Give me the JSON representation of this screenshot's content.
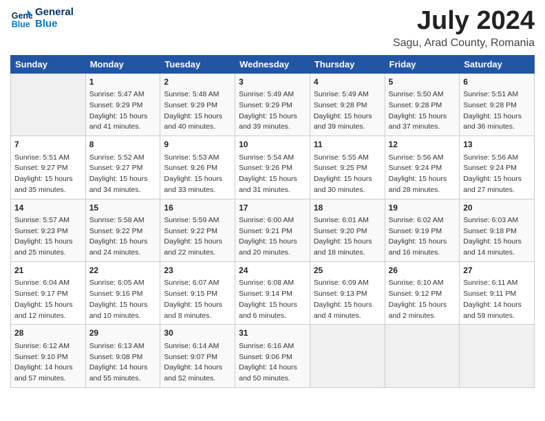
{
  "logo": {
    "line1": "General",
    "line2": "Blue"
  },
  "title": "July 2024",
  "subtitle": "Sagu, Arad County, Romania",
  "days_of_week": [
    "Sunday",
    "Monday",
    "Tuesday",
    "Wednesday",
    "Thursday",
    "Friday",
    "Saturday"
  ],
  "weeks": [
    [
      {
        "day": "",
        "info": ""
      },
      {
        "day": "1",
        "info": "Sunrise: 5:47 AM\nSunset: 9:29 PM\nDaylight: 15 hours\nand 41 minutes."
      },
      {
        "day": "2",
        "info": "Sunrise: 5:48 AM\nSunset: 9:29 PM\nDaylight: 15 hours\nand 40 minutes."
      },
      {
        "day": "3",
        "info": "Sunrise: 5:49 AM\nSunset: 9:29 PM\nDaylight: 15 hours\nand 39 minutes."
      },
      {
        "day": "4",
        "info": "Sunrise: 5:49 AM\nSunset: 9:28 PM\nDaylight: 15 hours\nand 39 minutes."
      },
      {
        "day": "5",
        "info": "Sunrise: 5:50 AM\nSunset: 9:28 PM\nDaylight: 15 hours\nand 37 minutes."
      },
      {
        "day": "6",
        "info": "Sunrise: 5:51 AM\nSunset: 9:28 PM\nDaylight: 15 hours\nand 36 minutes."
      }
    ],
    [
      {
        "day": "7",
        "info": "Sunrise: 5:51 AM\nSunset: 9:27 PM\nDaylight: 15 hours\nand 35 minutes."
      },
      {
        "day": "8",
        "info": "Sunrise: 5:52 AM\nSunset: 9:27 PM\nDaylight: 15 hours\nand 34 minutes."
      },
      {
        "day": "9",
        "info": "Sunrise: 5:53 AM\nSunset: 9:26 PM\nDaylight: 15 hours\nand 33 minutes."
      },
      {
        "day": "10",
        "info": "Sunrise: 5:54 AM\nSunset: 9:26 PM\nDaylight: 15 hours\nand 31 minutes."
      },
      {
        "day": "11",
        "info": "Sunrise: 5:55 AM\nSunset: 9:25 PM\nDaylight: 15 hours\nand 30 minutes."
      },
      {
        "day": "12",
        "info": "Sunrise: 5:56 AM\nSunset: 9:24 PM\nDaylight: 15 hours\nand 28 minutes."
      },
      {
        "day": "13",
        "info": "Sunrise: 5:56 AM\nSunset: 9:24 PM\nDaylight: 15 hours\nand 27 minutes."
      }
    ],
    [
      {
        "day": "14",
        "info": "Sunrise: 5:57 AM\nSunset: 9:23 PM\nDaylight: 15 hours\nand 25 minutes."
      },
      {
        "day": "15",
        "info": "Sunrise: 5:58 AM\nSunset: 9:22 PM\nDaylight: 15 hours\nand 24 minutes."
      },
      {
        "day": "16",
        "info": "Sunrise: 5:59 AM\nSunset: 9:22 PM\nDaylight: 15 hours\nand 22 minutes."
      },
      {
        "day": "17",
        "info": "Sunrise: 6:00 AM\nSunset: 9:21 PM\nDaylight: 15 hours\nand 20 minutes."
      },
      {
        "day": "18",
        "info": "Sunrise: 6:01 AM\nSunset: 9:20 PM\nDaylight: 15 hours\nand 18 minutes."
      },
      {
        "day": "19",
        "info": "Sunrise: 6:02 AM\nSunset: 9:19 PM\nDaylight: 15 hours\nand 16 minutes."
      },
      {
        "day": "20",
        "info": "Sunrise: 6:03 AM\nSunset: 9:18 PM\nDaylight: 15 hours\nand 14 minutes."
      }
    ],
    [
      {
        "day": "21",
        "info": "Sunrise: 6:04 AM\nSunset: 9:17 PM\nDaylight: 15 hours\nand 12 minutes."
      },
      {
        "day": "22",
        "info": "Sunrise: 6:05 AM\nSunset: 9:16 PM\nDaylight: 15 hours\nand 10 minutes."
      },
      {
        "day": "23",
        "info": "Sunrise: 6:07 AM\nSunset: 9:15 PM\nDaylight: 15 hours\nand 8 minutes."
      },
      {
        "day": "24",
        "info": "Sunrise: 6:08 AM\nSunset: 9:14 PM\nDaylight: 15 hours\nand 6 minutes."
      },
      {
        "day": "25",
        "info": "Sunrise: 6:09 AM\nSunset: 9:13 PM\nDaylight: 15 hours\nand 4 minutes."
      },
      {
        "day": "26",
        "info": "Sunrise: 6:10 AM\nSunset: 9:12 PM\nDaylight: 15 hours\nand 2 minutes."
      },
      {
        "day": "27",
        "info": "Sunrise: 6:11 AM\nSunset: 9:11 PM\nDaylight: 14 hours\nand 59 minutes."
      }
    ],
    [
      {
        "day": "28",
        "info": "Sunrise: 6:12 AM\nSunset: 9:10 PM\nDaylight: 14 hours\nand 57 minutes."
      },
      {
        "day": "29",
        "info": "Sunrise: 6:13 AM\nSunset: 9:08 PM\nDaylight: 14 hours\nand 55 minutes."
      },
      {
        "day": "30",
        "info": "Sunrise: 6:14 AM\nSunset: 9:07 PM\nDaylight: 14 hours\nand 52 minutes."
      },
      {
        "day": "31",
        "info": "Sunrise: 6:16 AM\nSunset: 9:06 PM\nDaylight: 14 hours\nand 50 minutes."
      },
      {
        "day": "",
        "info": ""
      },
      {
        "day": "",
        "info": ""
      },
      {
        "day": "",
        "info": ""
      }
    ]
  ]
}
